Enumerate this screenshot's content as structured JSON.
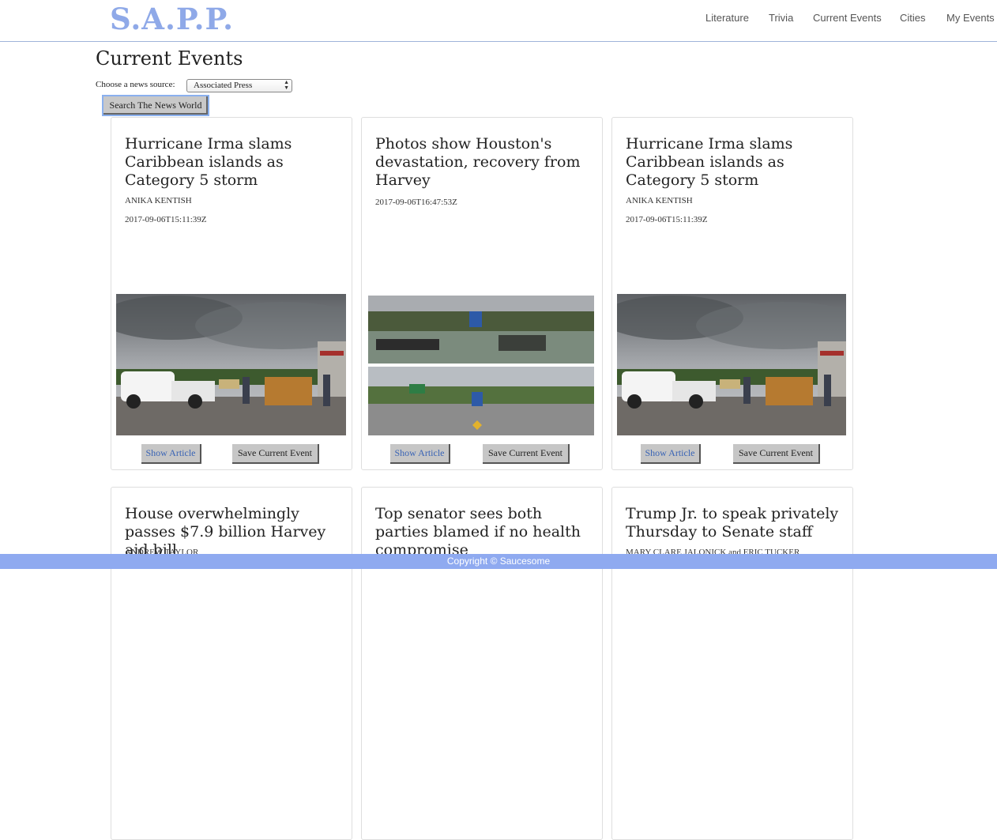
{
  "app": {
    "logo": "S.A.P.P."
  },
  "nav": {
    "literature": "Literature",
    "trivia": "Trivia",
    "current_events": "Current Events",
    "cities": "Cities",
    "my_events": "My Events"
  },
  "page": {
    "title": "Current Events",
    "source_label": "Choose a news source:",
    "source_selected": "Associated Press",
    "search_button": "Search The News World"
  },
  "cards": [
    {
      "title": "Hurricane Irma slams Caribbean islands as Category 5 storm",
      "author": "ANIKA KENTISH",
      "date": "2017-09-06T15:11:39Z",
      "show_label": "Show Article",
      "save_label": "Save Current Event"
    },
    {
      "title": "Photos show Houston's devastation, recovery from Harvey",
      "author": "",
      "date": "2017-09-06T16:47:53Z",
      "show_label": "Show Article",
      "save_label": "Save Current Event"
    },
    {
      "title": "Hurricane Irma slams Caribbean islands as Category 5 storm",
      "author": "ANIKA KENTISH",
      "date": "2017-09-06T15:11:39Z",
      "show_label": "Show Article",
      "save_label": "Save Current Event"
    },
    {
      "title": "House overwhelmingly passes $7.9 billion Harvey aid bill",
      "author": "ANDREW TAYLOR",
      "date": ""
    },
    {
      "title": "Top senator sees both parties blamed if no health compromise",
      "author": "",
      "date": ""
    },
    {
      "title": "Trump Jr. to speak privately Thursday to Senate staff",
      "author": "MARY CLARE JALONICK and ERIC TUCKER",
      "date": ""
    }
  ],
  "footer": {
    "text": "Copyright © Saucesome"
  },
  "colors": {
    "logo": "#8fa9e8",
    "footer_bg": "#8faaf0",
    "link": "#3a64b5",
    "button_bg": "#c6c6c6"
  }
}
